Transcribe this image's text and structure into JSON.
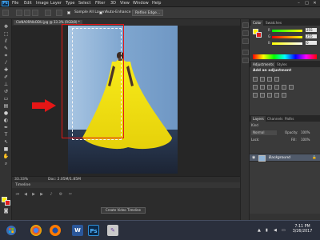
{
  "app": {
    "logo": "Ps",
    "window_controls": [
      "–",
      "□",
      "✕"
    ]
  },
  "menubar": {
    "items": [
      "File",
      "Edit",
      "Image",
      "Layer",
      "Type",
      "Select",
      "Filter",
      "3D",
      "View",
      "Window",
      "Help"
    ]
  },
  "options": {
    "sample_all_layers": "Sample All Layers",
    "auto_enhance": "Auto-Enhance",
    "refine_edge": "Refine Edge..."
  },
  "document": {
    "tab_title": "CleNA0RAIbODU.jpg @ 33.3% (RGB/8) *",
    "zoom": "33.33%",
    "doc_size": "Doc: 2.05M/1.85M"
  },
  "timeline": {
    "tab": "Timeline",
    "create_button": "Create Video Timeline"
  },
  "panels": {
    "color_tabs": [
      "Color",
      "Swatches"
    ],
    "rgb": [
      {
        "label": "R",
        "value": "255"
      },
      {
        "label": "G",
        "value": "255"
      },
      {
        "label": "B",
        "value": "0"
      }
    ],
    "adjustments_tabs": [
      "Adjustments",
      "Styles"
    ],
    "adjustments_title": "Add an adjustment",
    "layers_tabs": [
      "Layers",
      "Channels",
      "Paths"
    ],
    "layer_kind": "Kind",
    "blend_mode": "Normal",
    "opacity_label": "Opacity:",
    "opacity_value": "100%",
    "lock_label": "Lock:",
    "fill_label": "Fill:",
    "fill_value": "100%",
    "layer_name": "Background"
  },
  "colors": {
    "foreground": "#fff200",
    "background": "#e11d1d",
    "dress": "#f5e400",
    "annotation_red": "#e51616"
  },
  "taskbar": {
    "apps": [
      "chrome",
      "firefox",
      "word",
      "photoshop",
      "paint"
    ],
    "time": "7:11 PM",
    "date": "3/26/2017"
  }
}
